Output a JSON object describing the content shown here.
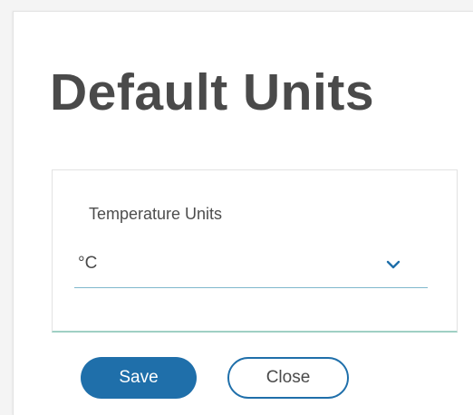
{
  "dialog": {
    "title": "Default Units"
  },
  "temperature_field": {
    "label": "Temperature Units",
    "selected_value": "°C",
    "dropdown_icon": "chevron-down-icon"
  },
  "buttons": {
    "save_label": "Save",
    "close_label": "Close"
  },
  "colors": {
    "primary": "#1f6faa",
    "title_text": "#4a4a4a",
    "field_underline": "#7fb8cc",
    "card_bottom_border": "#9fd0c4"
  }
}
